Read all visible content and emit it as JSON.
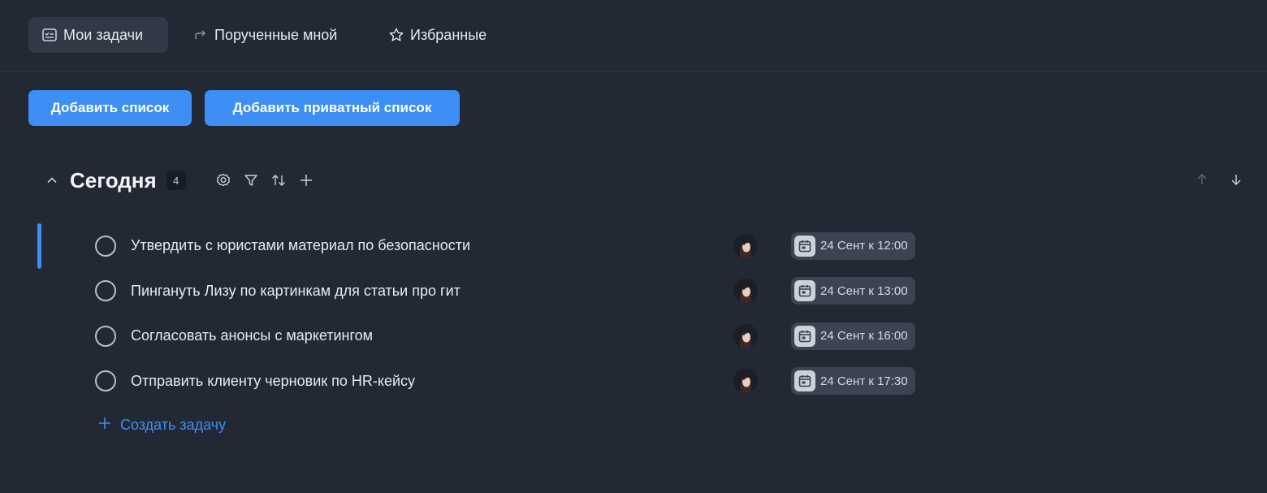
{
  "tabs": [
    {
      "label": "Мои задачи",
      "icon": "tasks-icon",
      "active": true
    },
    {
      "label": "Порученные мной",
      "icon": "forward-arrow-icon",
      "active": false
    },
    {
      "label": "Избранные",
      "icon": "star-icon",
      "active": false
    }
  ],
  "buttons": {
    "add_list": "Добавить список",
    "add_private_list": "Добавить приватный список"
  },
  "section": {
    "title": "Сегодня",
    "count": "4"
  },
  "tasks": [
    {
      "title": "Утвердить с юристами материал по безопасности",
      "date": "24 Сент к 12:00"
    },
    {
      "title": "Пингануть Лизу по картинкам для статьи про гит",
      "date": "24 Сент к 13:00"
    },
    {
      "title": "Согласовать анонсы с маркетингом",
      "date": "24 Сент к 16:00"
    },
    {
      "title": "Отправить клиенту черновик по HR-кейсу",
      "date": "24 Сент к 17:30"
    }
  ],
  "create_task": "Создать задачу",
  "colors": {
    "background": "#222834",
    "accent": "#3d8ef5",
    "chip": "#3c4351"
  }
}
